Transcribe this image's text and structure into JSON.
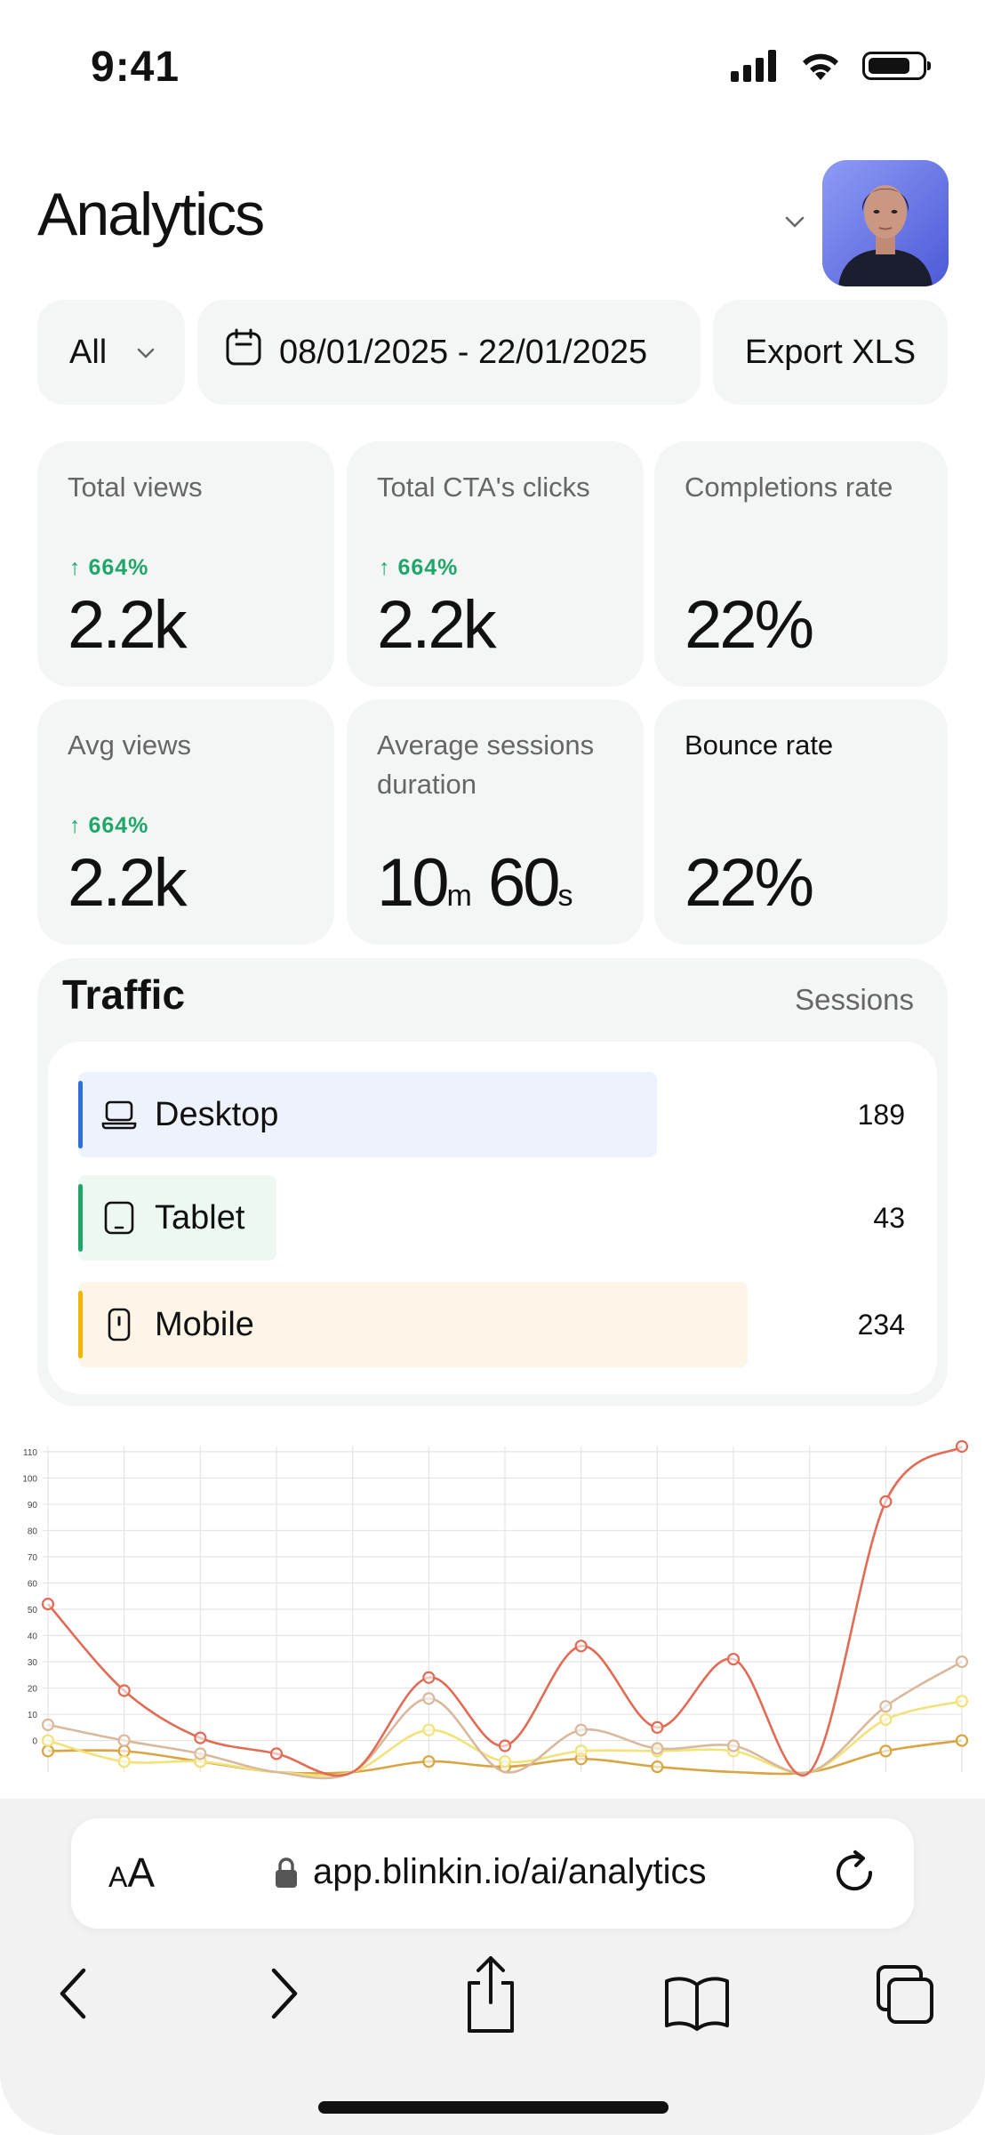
{
  "status": {
    "time": "9:41"
  },
  "header": {
    "title": "Analytics"
  },
  "filters": {
    "segment": "All",
    "date_range": "08/01/2025 - 22/01/2025",
    "export_label": "Export XLS"
  },
  "stats": [
    {
      "label": "Total views",
      "delta": "↑ 664%",
      "value": "2.2k"
    },
    {
      "label": "Total CTA's clicks",
      "delta": "↑ 664%",
      "value": "2.2k"
    },
    {
      "label": "Completions rate",
      "delta": "",
      "value": "22%"
    },
    {
      "label": "Avg views",
      "delta": "↑ 664%",
      "value": "2.2k"
    },
    {
      "label": "Average sessions duration",
      "delta": "",
      "minutes": "10",
      "minutes_unit": "m",
      "seconds": "60",
      "seconds_unit": "s"
    },
    {
      "label": "Bounce rate",
      "delta": "",
      "value": "22%"
    }
  ],
  "traffic": {
    "title": "Traffic",
    "column_label": "Sessions",
    "rows": [
      {
        "label": "Desktop",
        "value": "189",
        "icon": "laptop-icon",
        "color": "#2f6fe0",
        "fill": "#eef2fd",
        "share": 0.7
      },
      {
        "label": "Tablet",
        "value": "43",
        "icon": "tablet-icon",
        "color": "#1fa76a",
        "fill": "#edf8f2",
        "share": 0.24
      },
      {
        "label": "Mobile",
        "value": "234",
        "icon": "phone-icon",
        "color": "#f4b400",
        "fill": "#fdf5e8",
        "share": 0.81
      }
    ]
  },
  "chart_data": {
    "type": "line",
    "x": [
      0,
      1,
      2,
      3,
      4,
      5,
      6,
      7,
      8,
      9,
      10,
      11,
      12
    ],
    "y_ticks": [
      0,
      10,
      20,
      30,
      40,
      50,
      60,
      70,
      80,
      90,
      100,
      110
    ],
    "ylim": [
      -12,
      112
    ],
    "grid": true,
    "series": [
      {
        "color": "#e26b55",
        "values": [
          52,
          19,
          1,
          -5,
          -12,
          24,
          -2,
          36,
          5,
          31,
          -12,
          91,
          112
        ]
      },
      {
        "color": "#d9b89c",
        "values": [
          6,
          0,
          -5,
          -12,
          -12,
          16,
          -12,
          4,
          -3,
          -2,
          -12,
          13,
          30
        ]
      },
      {
        "color": "#f1e27a",
        "values": [
          0,
          -8,
          -8,
          -12,
          -12,
          4,
          -8,
          -4,
          -4,
          -4,
          -12,
          8,
          15
        ]
      },
      {
        "color": "#d9a441",
        "values": [
          -4,
          -4,
          -8,
          -12,
          -12,
          -8,
          -10,
          -7,
          -10,
          -12,
          -12,
          -4,
          0
        ]
      }
    ]
  },
  "browser": {
    "text_size_label": "AA",
    "url": "app.blinkin.io/ai/analytics"
  }
}
